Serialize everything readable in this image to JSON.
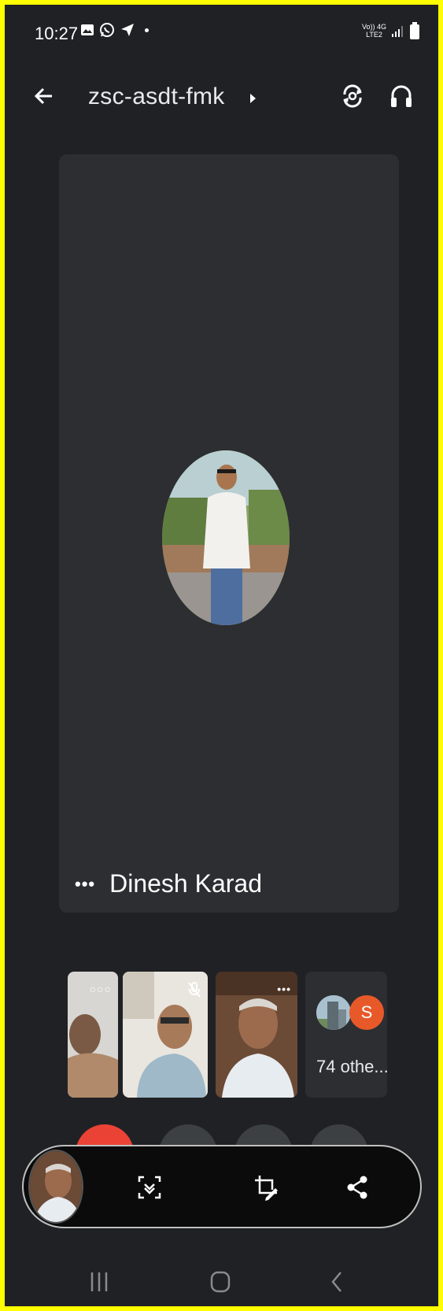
{
  "status_bar": {
    "time": "10:27",
    "network_top": "Vo)) 4G",
    "network_bottom": "LTE2"
  },
  "app_bar": {
    "meeting_code": "zsc-asdt-fmk",
    "icons": [
      "arrow-back-icon",
      "caret-right-icon",
      "flip-camera-icon",
      "headphones-icon"
    ]
  },
  "main_tile": {
    "participant_name": "Dinesh Karad",
    "more_label": "•••"
  },
  "filmstrip": {
    "others_label": "74 othe...",
    "others_initial": "S",
    "tiles": [
      {
        "name": "participant-1",
        "indicator": "•••"
      },
      {
        "name": "participant-2",
        "indicator": "muted"
      },
      {
        "name": "participant-3",
        "indicator": "•••"
      }
    ]
  },
  "screenshot_toolbar": {
    "actions": [
      "scroll-capture-icon",
      "crop-edit-icon",
      "share-icon"
    ]
  },
  "nav_bar": {
    "buttons": [
      "recents-icon",
      "home-icon",
      "back-icon"
    ]
  },
  "colors": {
    "frame": "#ffff00",
    "background": "#202124",
    "tile": "#2d2e31",
    "end_call": "#ea4335",
    "avatar_orange": "#e8592a"
  }
}
